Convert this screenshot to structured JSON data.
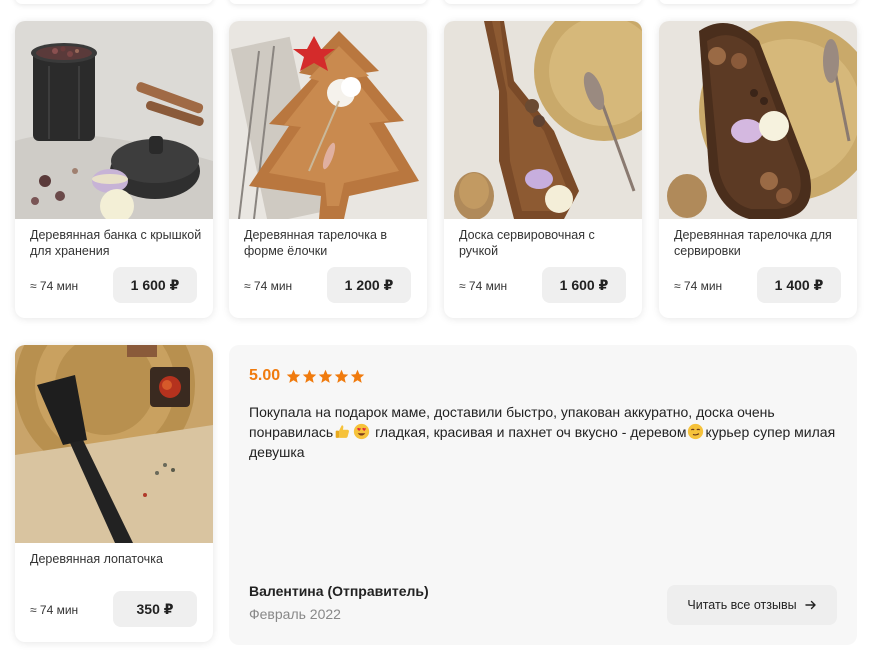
{
  "products": [
    {
      "title": "Деревянная банка с крышкой для хранения",
      "eta": "≈ 74 мин",
      "price": "1 600 ₽"
    },
    {
      "title": "Деревянная тарелочка в форме ёлочки",
      "eta": "≈ 74 мин",
      "price": "1 200 ₽"
    },
    {
      "title": "Доска сервировочная с ручкой",
      "eta": "≈ 74 мин",
      "price": "1 600 ₽"
    },
    {
      "title": "Деревянная тарелочка для сервировки",
      "eta": "≈ 74 мин",
      "price": "1 400 ₽"
    },
    {
      "title": "Деревянная лопаточка",
      "eta": "≈ 74 мин",
      "price": "350 ₽"
    }
  ],
  "review": {
    "rating": "5.00",
    "stars": 5,
    "text_part1": "Покупала на подарок маме, доставили быстро, упакован аккуратно, доска очень понравилась",
    "text_part2": " гладкая, красивая и пахнет оч вкусно - деревом",
    "text_part3": "курьер супер милая девушка",
    "author": "Валентина (Отправитель)",
    "date": "Февраль 2022",
    "all_reviews_label": "Читать все отзывы"
  },
  "colors": {
    "rating_accent": "#f07b0e",
    "price_bg": "#efefef",
    "review_bg": "#f7f7f7"
  },
  "icons": [
    "star-icon",
    "arrow-right-icon",
    "thumbs-up-emoji",
    "heart-eyes-emoji",
    "smirk-emoji"
  ]
}
